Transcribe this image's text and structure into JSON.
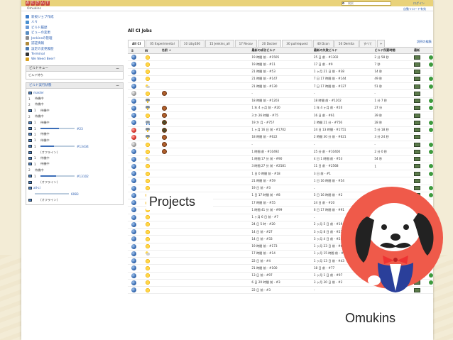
{
  "header": {
    "search_placeholder": "検索",
    "login": "ログイン",
    "breadcrumb": "Omukins",
    "auto_refresh": "自動リロード有効"
  },
  "sidebar": {
    "tasks": [
      {
        "label": "新規ジョブ作成",
        "icon": "new-job-icon",
        "color": "#3a7bc8"
      },
      {
        "label": "人々",
        "icon": "people-icon",
        "color": "#4a90d0"
      },
      {
        "label": "ビルド履歴",
        "icon": "history-icon",
        "color": "#6a9ad6"
      },
      {
        "label": "ビューの変更",
        "icon": "edit-view-icon",
        "color": "#5a8ec2"
      },
      {
        "label": "Jenkinsの管理",
        "icon": "manage-icon",
        "color": "#8a8a8a"
      },
      {
        "label": "認証情報",
        "icon": "credentials-icon",
        "color": "#b08a3a"
      },
      {
        "label": "設定の変更履歴",
        "icon": "config-history-icon",
        "color": "#4a7ab0"
      },
      {
        "label": "Terminal",
        "icon": "terminal-icon",
        "color": "#333333"
      },
      {
        "label": "We Need Beer!",
        "icon": "beer-icon",
        "color": "#d8a020"
      }
    ],
    "queue": {
      "title": "ビルドキュー",
      "empty": "ビルド待ち"
    },
    "executor": {
      "title": "ビルド実行状態",
      "rows": [
        {
          "node": "master",
          "n1": "1",
          "s1": "待機中",
          "n2": "2",
          "s2": "待機中"
        },
        {
          "node": "",
          "n1": "1",
          "s1": "待機中",
          "n2": "2",
          "s2": "待機中"
        },
        {
          "node": "",
          "n1": "1",
          "s1": "待機中",
          "n2": "",
          "s2": ""
        },
        {
          "node": "",
          "n1": "1",
          "s1": "",
          "n2": "",
          "s2": "",
          "build": "#23",
          "progress": 0.55
        },
        {
          "node": "",
          "n1": "1",
          "s1": "待機中",
          "n2": "",
          "s2": ""
        },
        {
          "node": "",
          "n1": "1",
          "s1": "待機中",
          "n2": "",
          "s2": ""
        },
        {
          "node": "",
          "n1": "1",
          "s1": "",
          "n2": "",
          "s2": "",
          "build": "#13434",
          "progress": 0.4
        },
        {
          "node": "",
          "n1": "",
          "s1": "(オフライン)",
          "n2": "",
          "s2": ""
        },
        {
          "node": "",
          "n1": "1",
          "s1": "待機中",
          "n2": "",
          "s2": ""
        },
        {
          "node": "",
          "n1": "1",
          "s1": "待機中",
          "n2": "2",
          "s2": "待機中"
        },
        {
          "node": "",
          "n1": "1",
          "s1": "",
          "n2": "",
          "s2": "",
          "build": "#13102",
          "progress": 0.45
        },
        {
          "node": "",
          "n1": "",
          "s1": "(オフライン)",
          "n2": "",
          "s2": ""
        },
        {
          "node": "all-ci",
          "n1": "",
          "s1": "",
          "n2": "",
          "s2": "",
          "build": "6083",
          "progress": 0
        },
        {
          "node": "",
          "n1": "",
          "s1": "(オフライン)",
          "n2": "",
          "s2": ""
        }
      ]
    }
  },
  "main": {
    "title": "All CI Jobs",
    "new_view": "説明の編集",
    "tabs": [
      "All CI",
      "05 Experimental",
      "10 Liby160",
      "15 Jenkins_all",
      "17 Recov",
      "20 Docker",
      "30 pullrequest",
      "40 Dcon",
      "50 Demita",
      "すべて",
      "+"
    ],
    "columns": {
      "s": "S",
      "w": "W",
      "name": "名前 ↓",
      "last_success": "最新の成功ビルド",
      "last_failure": "最新の失敗ビルド",
      "duration": "ビルド所要時間",
      "build": "最新"
    },
    "rows": [
      {
        "ball": "blue",
        "weather": "sunny",
        "fav": "",
        "ls": "19 時間 前 - #1505",
        "lf": "25 日 前 - #1302",
        "d": "2 分 58 秒"
      },
      {
        "ball": "blue",
        "weather": "sunny",
        "fav": "",
        "ls": "19 時間 前 - #11",
        "lf": "17 日 前 - #9",
        "d": "7 秒"
      },
      {
        "ball": "blue",
        "weather": "sunny",
        "fav": "",
        "ls": "21 時間 前 - #53",
        "lf": "1 ヶ月 21 日 前 - #38",
        "d": "14 秒"
      },
      {
        "ball": "blue",
        "weather": "sunny",
        "fav": "",
        "ls": "21 時間 前 - #147",
        "lf": "7 日 17 時間 前 - #144",
        "d": "49 秒"
      },
      {
        "ball": "blue",
        "weather": "partly",
        "fav": "",
        "ls": "21 時間 前 - #130",
        "lf": "7 日 17 時間 前 - #127",
        "d": "51 秒"
      },
      {
        "ball": "grey",
        "weather": "sunny",
        "fav": "brown",
        "ls": "-",
        "lf": "-",
        "d": "-"
      },
      {
        "ball": "blue",
        "weather": "storm",
        "fav": "",
        "ls": "18 時間 前 - #1203",
        "lf": "18 時間 前 - #1202",
        "d": "1 分 7 秒"
      },
      {
        "ball": "blue",
        "weather": "storm",
        "fav": "brown",
        "ls": "1 年 4 ヶ月 前 - #20",
        "lf": "1 年 4 ヶ月 前 - #20",
        "d": "27 分"
      },
      {
        "ball": "blue",
        "weather": "sunny",
        "fav": "brown",
        "ls": "3 か 26 時間 - #75",
        "lf": "16 日 前 - #61",
        "d": "39 秒"
      },
      {
        "ball": "blue",
        "weather": "rain",
        "fav": "dark",
        "ls": "19 か 月 - #757",
        "lf": "2 時間 21 分 - #756",
        "d": "28 秒"
      },
      {
        "ball": "red",
        "weather": "storm",
        "fav": "dark",
        "ls": "1 ヶ月 16 日 前 - #1702",
        "lf": "24 日 13 時間 - #1751",
        "d": "5 分 18 秒"
      },
      {
        "ball": "red",
        "weather": "storm",
        "fav": "brown",
        "ls": "18 時間 前 - #622",
        "lf": "2 時間 30 分 前 - #621",
        "d": "3 分 24 秒"
      },
      {
        "ball": "grey",
        "weather": "sunny",
        "fav": "brown",
        "ls": "-",
        "lf": "-",
        "d": "-"
      },
      {
        "ball": "blue",
        "weather": "sunny",
        "fav": "brown",
        "ls": "1 時間 前 - #10492",
        "lf": "25 分 前 - #10400",
        "d": "2 分 0 秒"
      },
      {
        "ball": "blue",
        "weather": "partly",
        "fav": "",
        "ls": "1 時間 17 分 前 - #90",
        "lf": "4 日 1 時間 前 - #53",
        "d": "54 秒"
      },
      {
        "ball": "blue",
        "weather": "sunny",
        "fav": "",
        "ls": "3 時間 27 分 前 - #2581",
        "lf": "11 日 前 - #2568",
        "d": "1"
      },
      {
        "ball": "blue",
        "weather": "sunny",
        "fav": "",
        "ls": "1 日 0 時間 前 - #18",
        "lf": "3 日 前 - #1",
        "d": ""
      },
      {
        "ball": "blue",
        "weather": "sunny",
        "fav": "",
        "ls": "21 時間 前 - #59",
        "lf": "1 日 16 時間 前 - #54",
        "d": ""
      },
      {
        "ball": "blue",
        "weather": "sunny",
        "fav": "",
        "ls": "19 日 前 - #3",
        "lf": "-",
        "d": ""
      },
      {
        "ball": "blue",
        "weather": "sunny",
        "fav": "",
        "ls": "1 日 17 時間 前 - #8",
        "lf": "5 日 16 時間 前 - #2",
        "d": ""
      },
      {
        "ball": "blue",
        "weather": "sunny",
        "fav": "",
        "ls": "17 時間 前 - #55",
        "lf": "24 日 前 - #20",
        "d": ""
      },
      {
        "ball": "blue",
        "weather": "sunny",
        "fav": "",
        "ls": "1 時間 41 分 前 - #99",
        "lf": "6 日 17 時間 前 - #91",
        "d": ""
      },
      {
        "ball": "blue",
        "weather": "sunny",
        "fav": "",
        "ls": "1 ヶ月 6 日 前 - #7",
        "lf": "-",
        "d": ""
      },
      {
        "ball": "blue",
        "weather": "sunny",
        "fav": "",
        "ls": "24 日 5 時 - #20",
        "lf": "2 ヶ月 5 日 前 - #19",
        "d": ""
      },
      {
        "ball": "blue",
        "weather": "sunny",
        "fav": "",
        "ls": "14 日 前 - #27",
        "lf": "3 ヶ月 8 日 前 - #21",
        "d": ""
      },
      {
        "ball": "blue",
        "weather": "sunny",
        "fav": "",
        "ls": "14 日 前 - #33",
        "lf": "3 ヶ月 4 日 前 - #28",
        "d": ""
      },
      {
        "ball": "blue",
        "weather": "sunny",
        "fav": "",
        "ls": "19 時間 前 - #173",
        "lf": "1 ヶ月 23 日 前 - #65",
        "d": ""
      },
      {
        "ball": "blue",
        "weather": "partly",
        "fav": "",
        "ls": "17 時間 前 - #14",
        "lf": "1 ヶ月 15 時間 前 - #12",
        "d": ""
      },
      {
        "ball": "blue",
        "weather": "sunny",
        "fav": "",
        "ls": "22 日 前 - #4",
        "lf": "1 ヶ月 13 日 前 - #43",
        "d": ""
      },
      {
        "ball": "blue",
        "weather": "sunny",
        "fav": "",
        "ls": "21 時間 前 - #100",
        "lf": "18 日 前 - #77",
        "d": ""
      },
      {
        "ball": "blue",
        "weather": "sunny",
        "fav": "",
        "ls": "13 日 前 - #97",
        "lf": "1 ヶ月 1 日 前 - #97",
        "d": ""
      },
      {
        "ball": "blue",
        "weather": "sunny",
        "fav": "",
        "ls": "6 日 20 時間 前 - #3",
        "lf": "3 ヶ月 30 日 前 - #2",
        "d": ""
      },
      {
        "ball": "blue",
        "weather": "sunny",
        "fav": "",
        "ls": "22 日 前 - #3",
        "lf": "-",
        "d": ""
      }
    ]
  },
  "overlay": {
    "projects": "Projects",
    "omukins": "Omukins"
  },
  "colors": {
    "header": "#e9d27a",
    "link": "#2a5db0",
    "mascot_bg": "#ef5a4a"
  }
}
